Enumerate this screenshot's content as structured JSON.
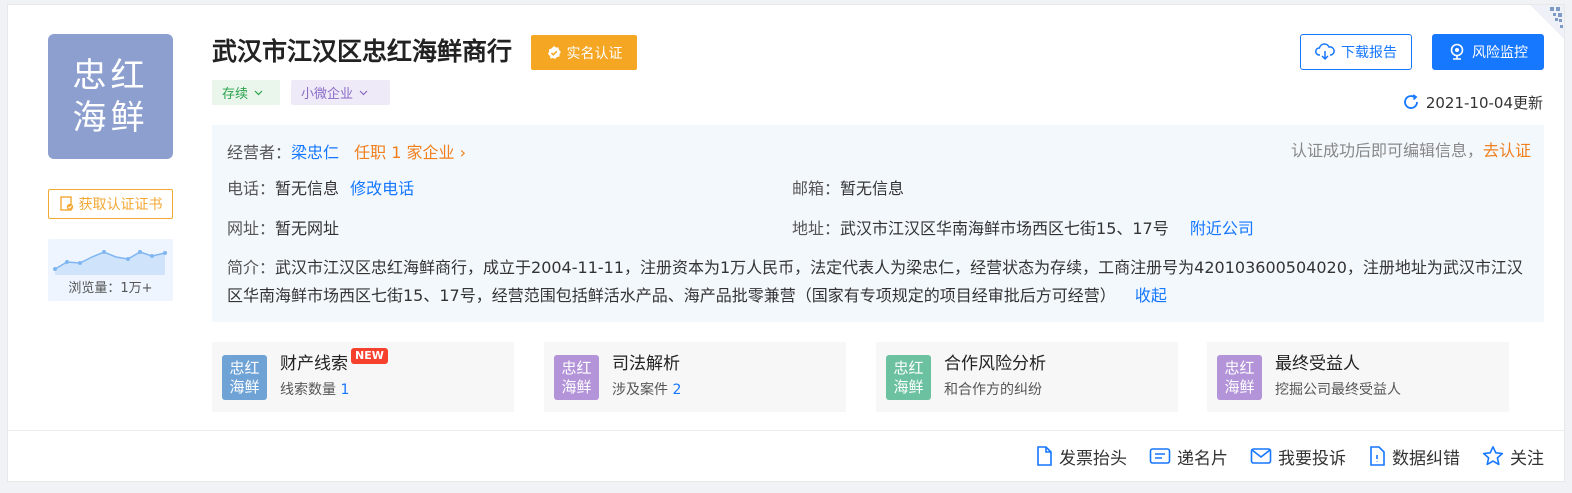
{
  "company": {
    "logo_line1": "忠红",
    "logo_line2": "海鲜",
    "name": "武汉市江汉区忠红海鲜商行",
    "verified_label": "实名认证",
    "tag_status": "存续",
    "tag_size": "小微企业"
  },
  "sidebar": {
    "cert_button": "获取认证证书",
    "views_label": "浏览量：1万+"
  },
  "actions": {
    "download_report": "下载报告",
    "risk_monitor": "风险监控",
    "updated": "2021-10-04更新"
  },
  "info": {
    "operator_label": "经营者：",
    "operator_name": "梁忠仁",
    "operator_positions": "任职 1 家企业",
    "edit_hint": "认证成功后即可编辑信息，",
    "go_verify": "去认证",
    "phone_label": "电话：",
    "phone_value": "暂无信息",
    "edit_phone": "修改电话",
    "email_label": "邮箱：",
    "email_value": "暂无信息",
    "website_label": "网址：",
    "website_value": "暂无网址",
    "address_label": "地址：",
    "address_value": "武汉市江汉区华南海鲜市场西区七街15、17号",
    "nearby": "附近公司",
    "intro_label": "简介：",
    "intro_text": "武汉市江汉区忠红海鲜商行，成立于2004-11-11，注册资本为1万人民币，法定代表人为梁忠仁，经营状态为存续，工商注册号为420103600504020，注册地址为武汉市江汉区华南海鲜市场西区七街15、17号，经营范围包括鲜活水产品、海产品批零兼营（国家有专项规定的项目经审批后方可经营）",
    "collapse": "收起"
  },
  "features": [
    {
      "av1": "忠红",
      "av2": "海鲜",
      "color": "#6fa3d6",
      "title": "财产线索",
      "badge": "NEW",
      "sub": "线索数量",
      "num": "1"
    },
    {
      "av1": "忠红",
      "av2": "海鲜",
      "color": "#b394d9",
      "title": "司法解析",
      "badge": "",
      "sub": "涉及案件",
      "num": "2"
    },
    {
      "av1": "忠红",
      "av2": "海鲜",
      "color": "#6cc1a0",
      "title": "合作风险分析",
      "badge": "",
      "sub": "和合作方的纠纷",
      "num": ""
    },
    {
      "av1": "忠红",
      "av2": "海鲜",
      "color": "#b394d9",
      "title": "最终受益人",
      "badge": "",
      "sub": "挖掘公司最终受益人",
      "num": ""
    }
  ],
  "footer": {
    "invoice": "发票抬头",
    "card": "递名片",
    "complaint": "我要投诉",
    "correction": "数据纠错",
    "follow": "关注"
  },
  "colors": {
    "brand_blue": "#1677ff",
    "verified_orange": "#f5a623",
    "logo_bg": "#8c9fce"
  }
}
